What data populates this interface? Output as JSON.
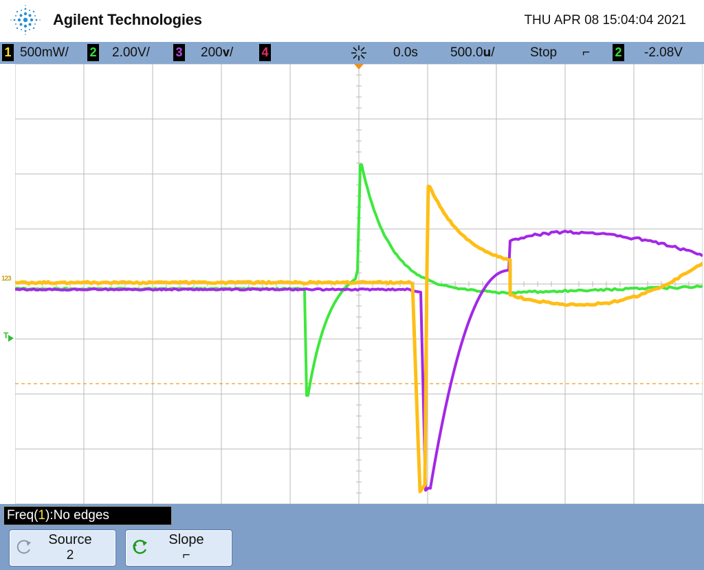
{
  "header": {
    "brand": "Agilent Technologies",
    "datetime": "THU APR 08 15:04:04 2021",
    "logo_icon": "agilent-spark-icon"
  },
  "status_bar": {
    "ch1_number": "1",
    "ch1_scale": "500mW/",
    "ch2_number": "2",
    "ch2_scale": "2.00V/",
    "ch3_number": "3",
    "ch3_scale": "200𝐯/",
    "ch4_number": "4",
    "trigger_icon": "trigger-burst-icon",
    "time_delay": "0.0s",
    "time_scale": "500.0𝐮/",
    "run_state": "Stop",
    "trigger_slope_symbol": "⌐",
    "trigger_source": "2",
    "trigger_level": "-2.08V"
  },
  "markers": {
    "trigger_level_marker": "T",
    "channel_markers": "123"
  },
  "colors": {
    "ch1": "#f6e032",
    "ch2": "#35e03a",
    "ch3": "#b44ad8",
    "ch4": "#e0306a",
    "trace_yellow": "#ffbe16",
    "trace_green": "#3ee83c",
    "trace_purple": "#a228e6",
    "grid": "#b8b8b8",
    "panel": "#7f9fc9",
    "statusbar": "#88a8cf"
  },
  "measurement": {
    "prefix": "Freq(",
    "channel": "1",
    "suffix": "):No edges"
  },
  "softkeys": [
    {
      "title": "Source",
      "value": "2",
      "icon": "rotate-knob-icon"
    },
    {
      "title": "Slope",
      "value": "⌐",
      "icon": "rotate-knob-active-icon"
    }
  ]
}
